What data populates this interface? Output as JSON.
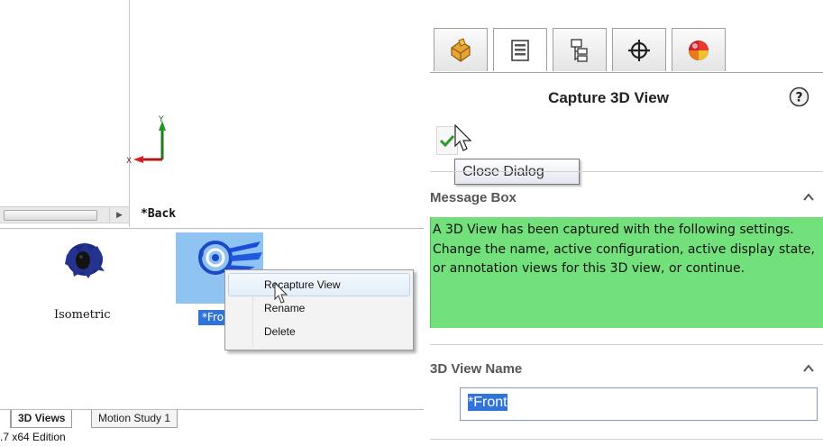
{
  "graphics": {
    "view_label": "*Back",
    "triad": {
      "x_label": "X",
      "y_label": "Y"
    }
  },
  "views_pane": {
    "items": [
      {
        "label": "Isometric"
      },
      {
        "label": "*Front"
      }
    ],
    "context_menu": [
      {
        "label": "Recapture View",
        "hover": true
      },
      {
        "label": "Rename",
        "hover": false
      },
      {
        "label": "Delete",
        "hover": false
      }
    ]
  },
  "bottom_tabs": [
    {
      "label": "3D Views",
      "active": true
    },
    {
      "label": "Motion Study 1",
      "active": false
    }
  ],
  "status_bar": {
    "text": ".7 x64 Edition"
  },
  "property_manager": {
    "tabs": [
      {
        "icon": "feature-manager-icon"
      },
      {
        "icon": "property-manager-icon"
      },
      {
        "icon": "configuration-manager-icon"
      },
      {
        "icon": "dim-xpert-manager-icon"
      },
      {
        "icon": "display-manager-icon"
      }
    ],
    "title": "Capture 3D View",
    "tooltip": "Close Dialog",
    "message_box": {
      "header": "Message Box",
      "text": "A 3D View has been captured with the following settings.  Change the name, active configuration, active display state, or annotation views for this 3D view, or continue."
    },
    "view_name": {
      "header": "3D View Name",
      "value": "*Front"
    }
  },
  "colors": {
    "message_green": "#72e07b",
    "selection_blue": "#3174d9",
    "thumb_highlight": "#8fc4f2"
  }
}
